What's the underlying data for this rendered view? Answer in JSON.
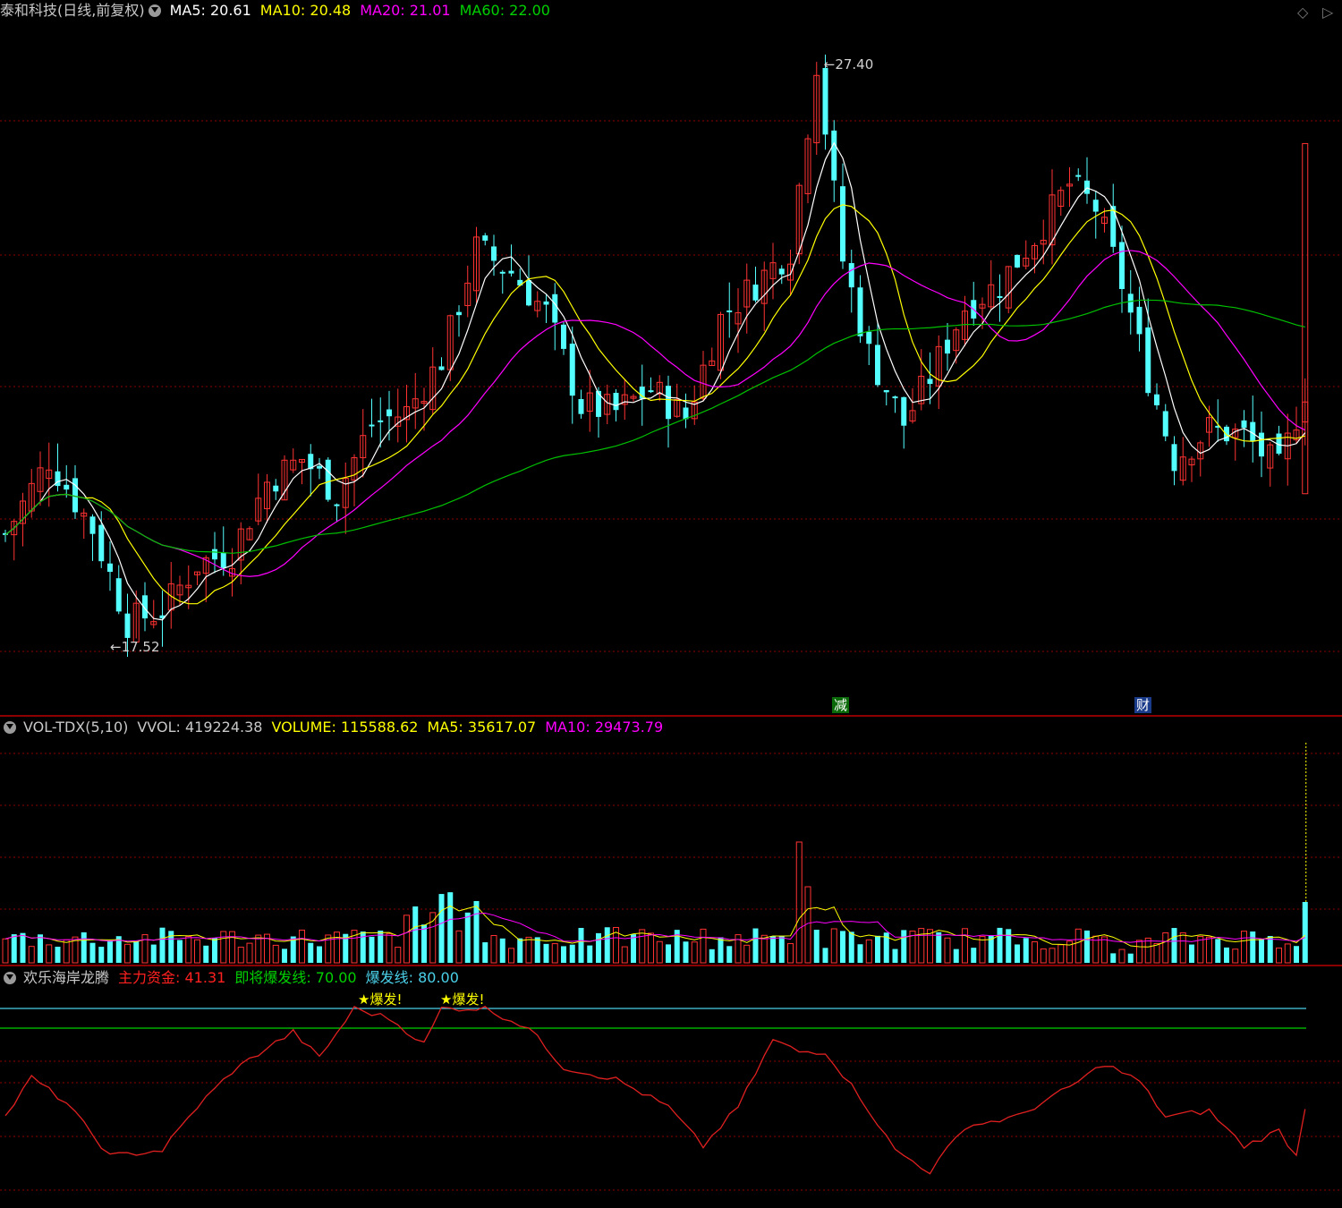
{
  "main_header": {
    "title": "泰和科技(日线,前复权)",
    "ma5": "MA5: 20.61",
    "ma10": "MA10: 20.48",
    "ma20": "MA20: 21.01",
    "ma60": "MA60: 22.00"
  },
  "vol_header": {
    "title": "VOL-TDX(5,10)",
    "vvol": "VVOL: 419224.38",
    "volume": "VOLUME: 115588.62",
    "ma5": "MA5: 35617.07",
    "ma10": "MA10: 29473.79"
  },
  "ind_header": {
    "title": "欢乐海岸龙腾",
    "main": "主力资金: 41.31",
    "near": "即将爆发线: 70.00",
    "burst": "爆发线: 80.00"
  },
  "signals": {
    "burst1": "★爆发!",
    "burst2": "★爆发!",
    "tag_jian": "减",
    "tag_cai": "财"
  },
  "colors": {
    "up": "#ff3232",
    "down": "#54ffff",
    "ma5": "#ffffff",
    "ma10": "#ffff00",
    "ma20": "#ff00ff",
    "ma60": "#00c000",
    "grid": "#8b0000"
  },
  "chart_data": [
    {
      "type": "candlestick",
      "annotations": {
        "high": "27.40",
        "low": "17.52"
      },
      "series": [
        "MA5",
        "MA10",
        "MA20",
        "MA60"
      ]
    },
    {
      "type": "bar",
      "name": "VOL-TDX(5,10)"
    },
    {
      "type": "line",
      "name": "欢乐海岸龙腾",
      "hlines": [
        70,
        80
      ]
    }
  ]
}
